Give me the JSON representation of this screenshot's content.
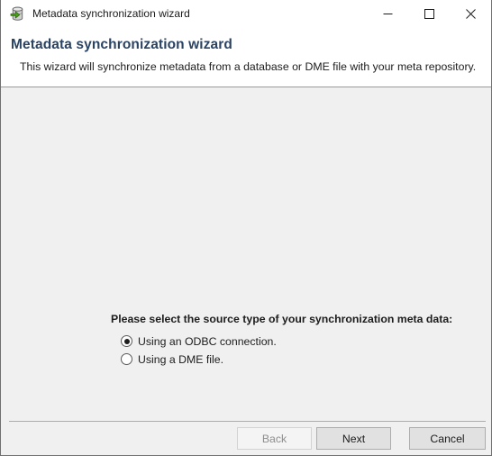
{
  "window": {
    "title": "Metadata synchronization wizard",
    "icon": "database-sync-icon",
    "controls": {
      "minimize": "minimize-icon",
      "maximize": "maximize-icon",
      "close": "close-icon"
    }
  },
  "header": {
    "title": "Metadata synchronization wizard",
    "subtitle": "This wizard will synchronize metadata from a database or DME file with your meta repository."
  },
  "main": {
    "prompt": "Please select the source type of your synchronization meta data:",
    "options": [
      {
        "label": "Using an ODBC connection.",
        "selected": true
      },
      {
        "label": "Using a DME file.",
        "selected": false
      }
    ]
  },
  "footer": {
    "buttons": [
      {
        "label": "Back",
        "enabled": false
      },
      {
        "label": "Next",
        "enabled": true
      },
      {
        "label": "Cancel",
        "enabled": true
      }
    ]
  },
  "colors": {
    "header_title": "#2b4362",
    "body_background": "#f0f0f0",
    "titlebar_background": "#ffffff",
    "window_border": "#707070",
    "separator": "#acacac",
    "button_face": "#e1e1e1",
    "button_border": "#adadad",
    "disabled_text": "#8e8e8e",
    "icon_accent_green": "#4aa017"
  }
}
